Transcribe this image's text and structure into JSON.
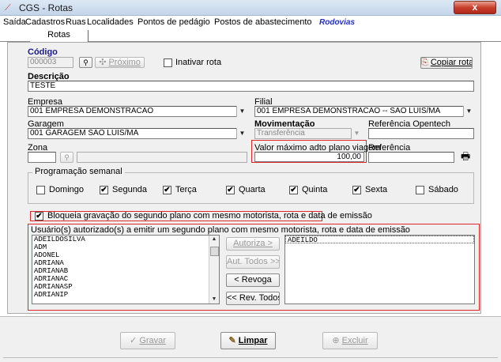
{
  "window": {
    "title": "CGS - Rotas",
    "close_label": "x"
  },
  "menu": {
    "items": [
      "Saída",
      "Cadastros",
      "Ruas",
      "Localidades",
      "Pontos de pedágio",
      "Postos de abastecimento"
    ],
    "brand": "Rodovias"
  },
  "tab": {
    "label": "Rotas"
  },
  "codigo": {
    "label": "Código",
    "value": "000003"
  },
  "proximo_button": "Próximo",
  "inativar": {
    "label": "Inativar rota",
    "checked": false
  },
  "copiar_button": "Copiar rota",
  "descricao": {
    "label": "Descrição",
    "value": "TESTE"
  },
  "empresa": {
    "label": "Empresa",
    "value": "001 EMPRESA DEMONSTRACAO"
  },
  "filial": {
    "label": "Filial",
    "value": "001 EMPRESA DEMONSTRACAO -- SAO LUIS/MA"
  },
  "garagem": {
    "label": "Garagem",
    "value": "001 GARAGEM SÃO LUIS/MA"
  },
  "movimentacao": {
    "label": "Movimentação",
    "value": "Transferência"
  },
  "referencia_opentech": {
    "label": "Referência Opentech",
    "value": ""
  },
  "zona": {
    "label": "Zona",
    "value": "",
    "desc": ""
  },
  "valor_maximo": {
    "label": "Valor máximo adto plano viagem",
    "value": "100,00"
  },
  "referencia": {
    "label": "Referência",
    "value": ""
  },
  "programacao": {
    "title": "Programação semanal",
    "days": [
      {
        "label": "Domingo",
        "checked": false
      },
      {
        "label": "Segunda",
        "checked": true
      },
      {
        "label": "Terça",
        "checked": true
      },
      {
        "label": "Quarta",
        "checked": true
      },
      {
        "label": "Quinta",
        "checked": true
      },
      {
        "label": "Sexta",
        "checked": true
      },
      {
        "label": "Sábado",
        "checked": false
      }
    ]
  },
  "bloqueia": {
    "label": "Bloqueia gravação do segundo plano com mesmo motorista, rota e data de emissão",
    "checked": true
  },
  "usuarios": {
    "label": "Usuário(s) autorizado(s) a emitir um segundo plano com mesmo motorista, rota e data de emissão",
    "available": [
      "ADEILDOSILVA",
      "ADM",
      "ADONEL",
      "ADRIANA",
      "ADRIANAB",
      "ADRIANAC",
      "ADRIANASP",
      "ADRIANIP"
    ],
    "authorized": [
      "ADEILDO"
    ]
  },
  "transfer_buttons": {
    "autoriza": "Autoriza >",
    "aut_todos": "Aut. Todos >>",
    "revoga": "< Revoga",
    "rev_todos": "<< Rev. Todos"
  },
  "footer": {
    "gravar": "Gravar",
    "limpar": "Limpar",
    "excluir": "Excluir"
  },
  "colors": {
    "highlight_box": "#e0282a",
    "brand_blue": "#2030c0"
  }
}
